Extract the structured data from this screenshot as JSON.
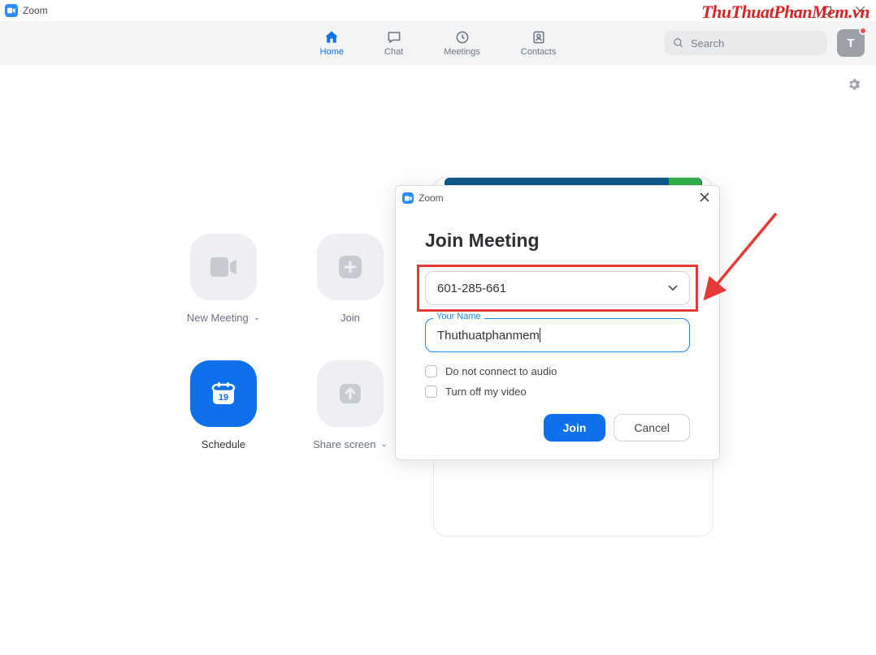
{
  "app": {
    "title": "Zoom"
  },
  "watermark": "ThuThuatPhanMem.vn",
  "nav": {
    "tabs": [
      {
        "label": "Home"
      },
      {
        "label": "Chat"
      },
      {
        "label": "Meetings"
      },
      {
        "label": "Contacts"
      }
    ],
    "search_placeholder": "Search",
    "avatar_initial": "T"
  },
  "tiles": {
    "new_meeting": "New Meeting",
    "join": "Join",
    "schedule": "Schedule",
    "share_screen": "Share screen",
    "calendar_day": "19"
  },
  "dialog": {
    "window_title": "Zoom",
    "heading": "Join Meeting",
    "meeting_id": "601-285-661",
    "name_label": "Your Name",
    "name_value": "Thuthuatphanmem",
    "opt_audio": "Do not connect to audio",
    "opt_video": "Turn off my video",
    "join_btn": "Join",
    "cancel_btn": "Cancel"
  },
  "colors": {
    "primary": "#0e71eb",
    "highlight": "#e53935"
  }
}
